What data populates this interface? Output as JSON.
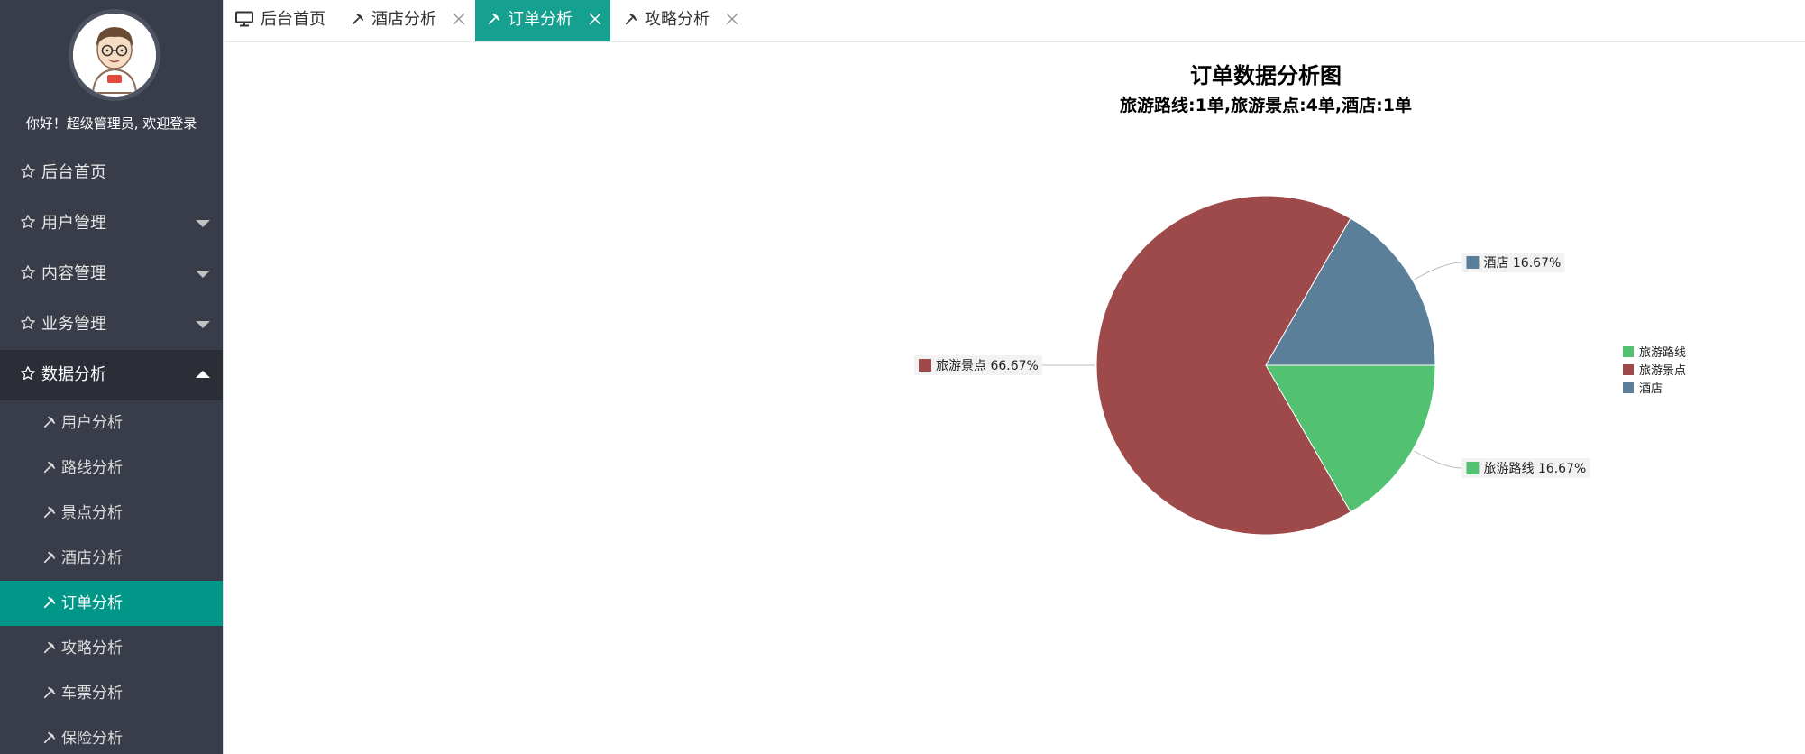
{
  "sidebar": {
    "welcome": "你好！超级管理员, 欢迎登录",
    "menu": [
      {
        "label": "后台首页",
        "icon": "star-outline-icon",
        "has_arrow": false
      },
      {
        "label": "用户管理",
        "icon": "star-outline-icon",
        "has_arrow": true
      },
      {
        "label": "内容管理",
        "icon": "star-outline-icon",
        "has_arrow": true
      },
      {
        "label": "业务管理",
        "icon": "star-outline-icon",
        "has_arrow": true
      },
      {
        "label": "数据分析",
        "icon": "star-outline-icon",
        "has_arrow": true,
        "open": true
      }
    ],
    "sub_items": [
      {
        "label": "用户分析",
        "icon": "tools-icon"
      },
      {
        "label": "路线分析",
        "icon": "tools-icon"
      },
      {
        "label": "景点分析",
        "icon": "tools-icon"
      },
      {
        "label": "酒店分析",
        "icon": "tools-icon"
      },
      {
        "label": "订单分析",
        "icon": "tools-icon",
        "active": true
      },
      {
        "label": "攻略分析",
        "icon": "tools-icon"
      },
      {
        "label": "车票分析",
        "icon": "tools-icon"
      },
      {
        "label": "保险分析",
        "icon": "tools-icon"
      }
    ]
  },
  "tabs": [
    {
      "label": "后台首页",
      "icon": "monitor-icon",
      "closable": false
    },
    {
      "label": "酒店分析",
      "icon": "tools-icon",
      "closable": true
    },
    {
      "label": "订单分析",
      "icon": "tools-icon",
      "closable": true,
      "active": true
    },
    {
      "label": "攻略分析",
      "icon": "tools-icon",
      "closable": true
    }
  ],
  "colors": {
    "sidebar_bg": "#393D49",
    "accent": "#009688",
    "tab_active": "#16A08F"
  },
  "chart_data": {
    "type": "pie",
    "title": "订单数据分析图",
    "subtitle": "旅游路线:1单,旅游景点:4单,酒店:1单",
    "slices": [
      {
        "name": "旅游路线",
        "value": 1,
        "percent_label": "16.67%",
        "color": "#52C172"
      },
      {
        "name": "旅游景点",
        "value": 4,
        "percent_label": "66.67%",
        "color": "#9E4A4B"
      },
      {
        "name": "酒店",
        "value": 1,
        "percent_label": "16.67%",
        "color": "#5B7F99"
      }
    ],
    "legend": [
      "旅游路线",
      "旅游景点",
      "酒店"
    ],
    "legend_position": "right"
  }
}
